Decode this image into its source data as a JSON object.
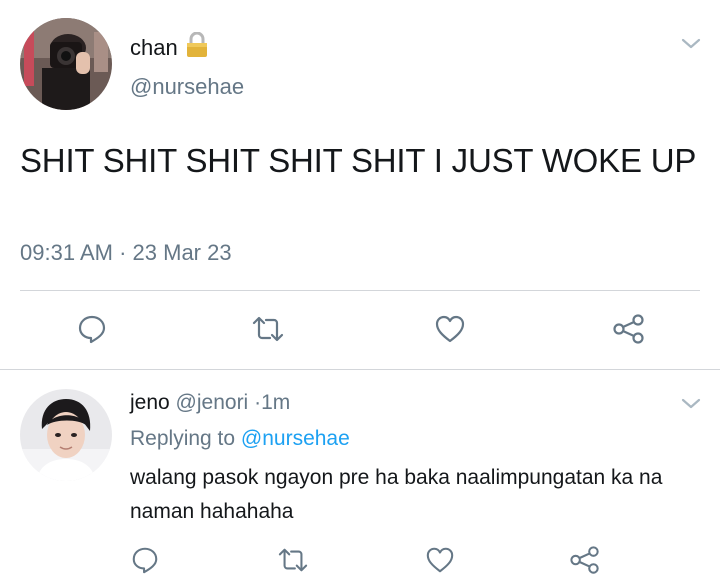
{
  "tweet": {
    "author_name": "chan",
    "handle": "@nursehae",
    "text": "SHIT SHIT SHIT SHIT SHIT I JUST WOKE UP",
    "time": "09:31 AM",
    "separator": "·",
    "date": "23 Mar 23",
    "lock_icon": "lock-icon"
  },
  "reply": {
    "author_name": "jeno",
    "handle": "@jenori",
    "separator": "·",
    "age": "1m",
    "replying_prefix": "Replying to",
    "replying_to": "@nursehae",
    "text": "walang pasok ngayon pre ha baka naalimpungatan ka na naman hahahaha"
  },
  "actions": [
    "reply-icon",
    "retweet-icon",
    "like-icon",
    "share-icon"
  ],
  "colors": {
    "text": "#14171a",
    "secondary": "#657786",
    "link": "#1da1f2",
    "divider": "#d3d6da"
  }
}
